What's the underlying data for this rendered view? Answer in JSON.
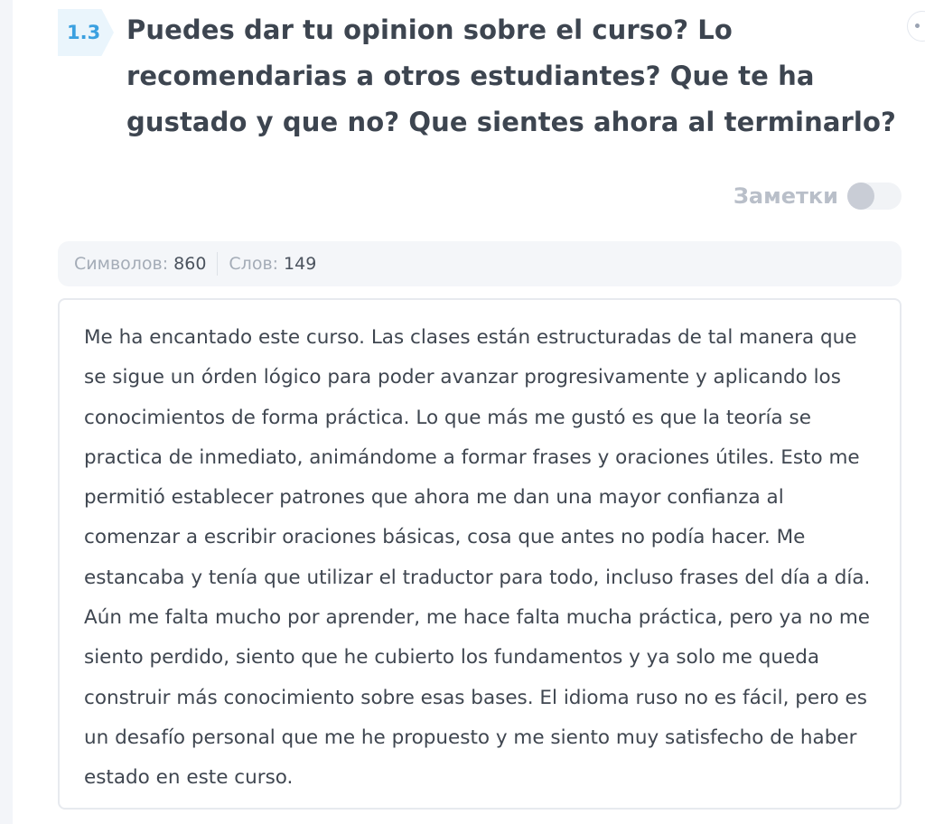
{
  "question": {
    "number": "1.3",
    "text": "Puedes dar tu opinion sobre el curso? Lo recomendarias a otros estudiantes? Que te ha gustado y que no? Que sientes ahora al terminarlo?"
  },
  "notes": {
    "label": "Заметки",
    "enabled": false
  },
  "counters": {
    "chars_label": "Символов:",
    "chars_value": "860",
    "words_label": "Слов:",
    "words_value": "149"
  },
  "answer": {
    "text": "Me ha encantado este curso. Las clases están estructuradas de tal manera que se sigue un órden lógico para poder avanzar progresivamente y aplicando los conocimientos de forma práctica. Lo que más me gustó es que la teoría se practica de inmediato, animándome a formar frases y oraciones útiles. Esto me permitió establecer patrones que ahora me dan una mayor confianza al comenzar a escribir oraciones básicas, cosa que antes no podía hacer. Me estancaba y tenía que utilizar el traductor para todo, incluso frases del día a día. Aún me falta mucho por aprender, me hace falta mucha práctica, pero ya no me siento perdido, siento que he cubierto los fundamentos y ya solo me queda construir más conocimiento sobre esas bases. El idioma ruso no es fácil, pero es un desafío personal que me he propuesto y me siento muy satisfecho de haber estado en este curso."
  },
  "colors": {
    "accent": "#3aa0e0",
    "badge_bg": "#eaf5fc",
    "heading": "#3d4550",
    "muted": "#b9bfc9"
  }
}
